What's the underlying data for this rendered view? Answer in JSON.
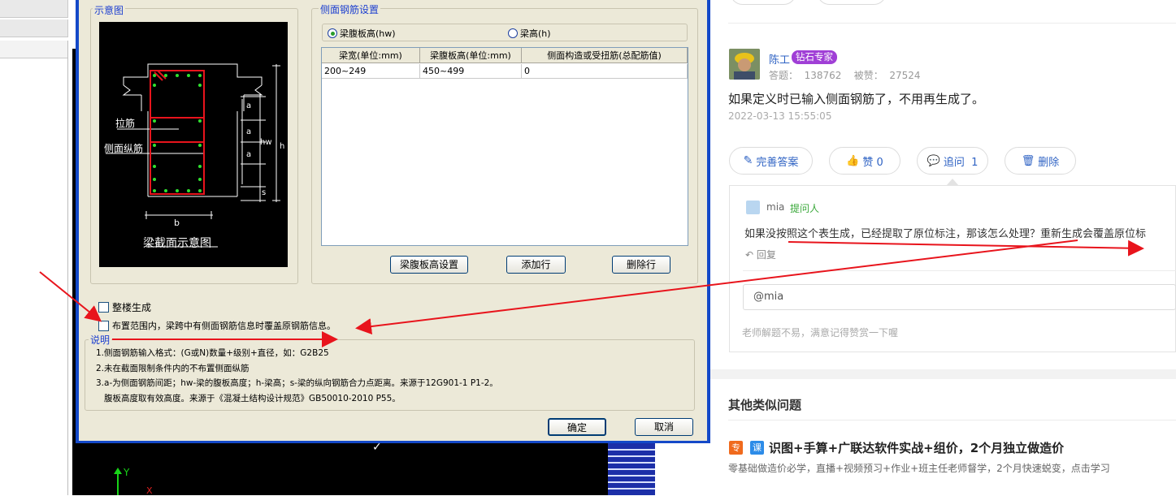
{
  "dialog": {
    "diagram_group_title": "示意图",
    "diagram": {
      "label_lajin": "拉筋",
      "label_cemian": "侧面纵筋",
      "label_a": "a",
      "label_hw": "hw",
      "label_h": "h",
      "label_s": "s",
      "label_b": "b",
      "caption": "梁截面示意图"
    },
    "settings_group_title": "侧面钢筋设置",
    "radio_options": [
      {
        "label": "梁腹板高(hw)",
        "selected": true
      },
      {
        "label": "梁高(h)",
        "selected": false
      }
    ],
    "table": {
      "columns": [
        "梁宽(单位:mm)",
        "梁腹板高(单位:mm)",
        "侧面构造或受扭筋(总配筋值)"
      ],
      "rows": [
        [
          "200~249",
          "450~499",
          "0"
        ]
      ]
    },
    "buttons": {
      "web_height": "梁腹板高设置",
      "add_row": "添加行",
      "delete_row": "删除行",
      "ok": "确定",
      "cancel": "取消"
    },
    "checkboxes": [
      {
        "label": "整楼生成",
        "checked": false
      },
      {
        "label": "布置范围内，梁跨中有侧面钢筋信息时覆盖原钢筋信息。",
        "checked": false
      }
    ],
    "notes_title": "说明",
    "notes": [
      "1.侧面钢筋输入格式：(G或N)数量+级别+直径，如：G2B25",
      "2.未在截面限制条件内的不布置侧面纵筋",
      "3.a-为侧面钢筋间距；hw-梁的腹板高度；h-梁高；s-梁的纵向钢筋合力点距离。来源于12G901-1 P1-2。",
      "   腹板高度取有效高度。来源于《混凝土结构设计规范》GB50010-2010 P55。"
    ]
  },
  "cad": {
    "axis_y": "Y",
    "axis_x": "X"
  },
  "answer": {
    "author": "陈工",
    "badge": "钻石专家",
    "stats": "答题：  138762    被赞：  27524",
    "text": "如果定义时已输入侧面钢筋了，不用再生成了。",
    "time": "2022-03-13 15:55:05",
    "actions": {
      "improve": "完善答案",
      "like": "赞 0",
      "followup": "追问  1",
      "delete": "删除"
    }
  },
  "followup": {
    "user": "mia",
    "role": "提问人",
    "text": "如果没按照这个表生成，已经提取了原位标注，那该怎么处理？重新生成会覆盖原位标",
    "reply": "回复",
    "input_value": "@mia",
    "hint": "老师解题不易，满意记得赞赏一下喔"
  },
  "similar": {
    "heading": "其他类似问题",
    "tag1": "专",
    "tag2": "课",
    "title": "识图+手算+广联达软件实战+组价，2个月独立做造价",
    "desc": "零基础做造价必学，直播+视频预习+作业+班主任老师督学，2个月快速蜕变，点击学习"
  },
  "colors": {
    "dialog_frame": "#1449c8",
    "dialog_bg": "#ece9d8",
    "link_blue": "#2f63c4",
    "badge_purple": "#a03fd6",
    "annotation_red": "#e8141c",
    "asker_green": "#3aa83a"
  }
}
